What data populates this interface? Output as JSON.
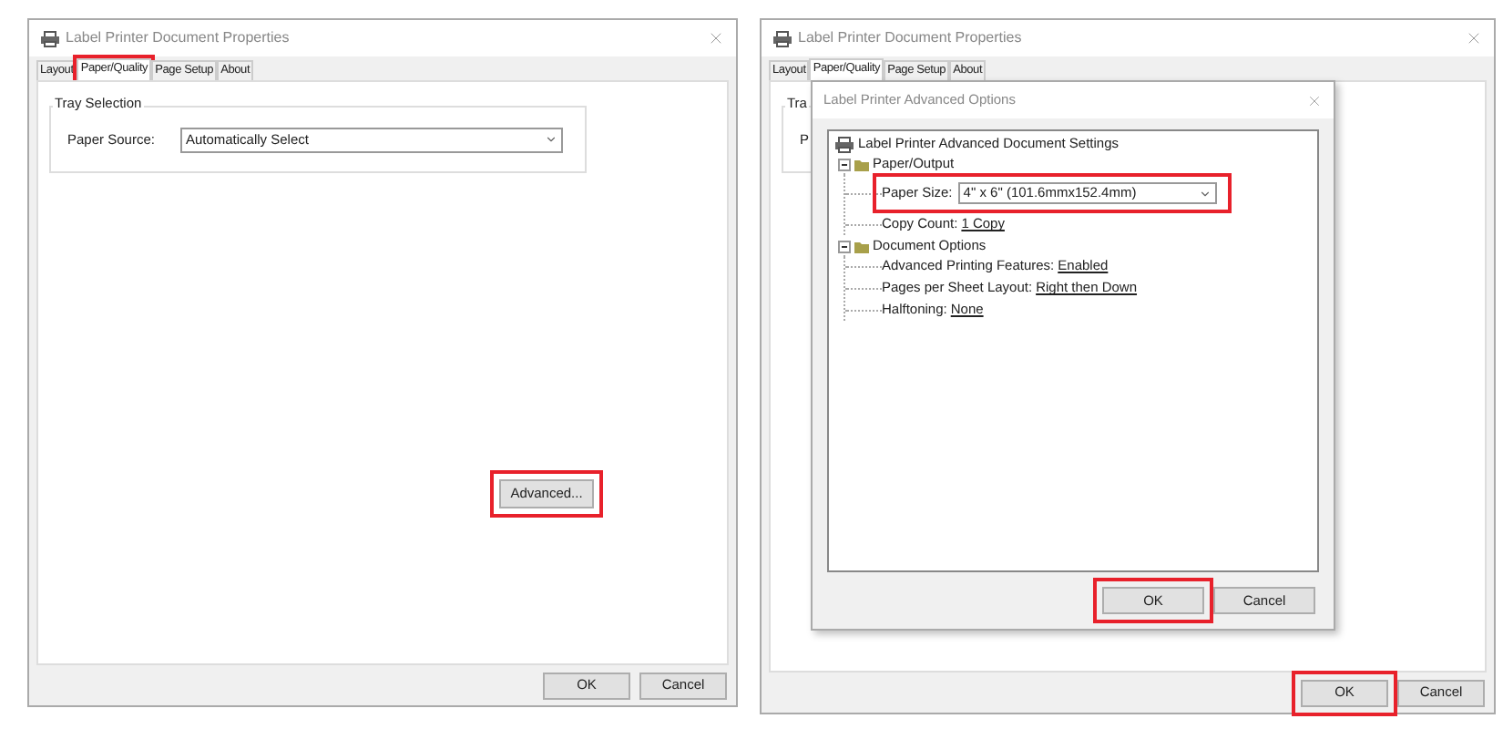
{
  "windows": [
    {
      "title": "Label Printer Document Properties",
      "tabs": [
        {
          "label": "Layout",
          "selected": false,
          "highlighted": false
        },
        {
          "label": "Paper/Quality",
          "selected": true,
          "highlighted": true
        },
        {
          "label": "Page Setup",
          "selected": false,
          "highlighted": false
        },
        {
          "label": "About",
          "selected": false,
          "highlighted": false
        }
      ],
      "tray": {
        "legend": "Tray Selection",
        "label": "Paper Source:",
        "value": "Automatically Select"
      },
      "advanced_button": {
        "label": "Advanced...",
        "highlighted": true
      },
      "buttons": [
        {
          "label": "OK",
          "highlighted": false
        },
        {
          "label": "Cancel",
          "highlighted": false
        }
      ]
    },
    {
      "title": "Label Printer Document Properties",
      "tabs": [
        {
          "label": "Layout",
          "selected": false,
          "highlighted": false
        },
        {
          "label": "Paper/Quality",
          "selected": true,
          "highlighted": false
        },
        {
          "label": "Page Setup",
          "selected": false,
          "highlighted": false
        },
        {
          "label": "About",
          "selected": false,
          "highlighted": false
        }
      ],
      "tray": {
        "legend": "Tra",
        "label": "P"
      },
      "buttons": [
        {
          "label": "OK",
          "highlighted": true
        },
        {
          "label": "Cancel",
          "highlighted": false
        }
      ],
      "dialog": {
        "title": "Label Printer Advanced Options",
        "tree": {
          "label": "Label Printer Advanced Document Settings",
          "children": [
            {
              "kind": "group",
              "label": "Paper/Output",
              "expanded": true,
              "children": [
                {
                  "kind": "dropdown",
                  "label": "Paper Size:",
                  "value": "4\" x 6\" (101.6mmx152.4mm)",
                  "highlighted": true
                },
                {
                  "kind": "link",
                  "label": "Copy Count:",
                  "value": "1 Copy",
                  "highlighted": false
                }
              ]
            },
            {
              "kind": "group",
              "label": "Document Options",
              "expanded": true,
              "children": [
                {
                  "kind": "link",
                  "label": "Advanced Printing Features:",
                  "value": "Enabled",
                  "highlighted": false
                },
                {
                  "kind": "link",
                  "label": "Pages per Sheet Layout:",
                  "value": "Right then Down",
                  "highlighted": false
                },
                {
                  "kind": "link",
                  "label": "Halftoning:",
                  "value": "None",
                  "highlighted": false
                }
              ]
            }
          ]
        },
        "buttons": [
          {
            "label": "OK",
            "highlighted": true
          },
          {
            "label": "Cancel",
            "highlighted": false
          }
        ]
      }
    }
  ]
}
